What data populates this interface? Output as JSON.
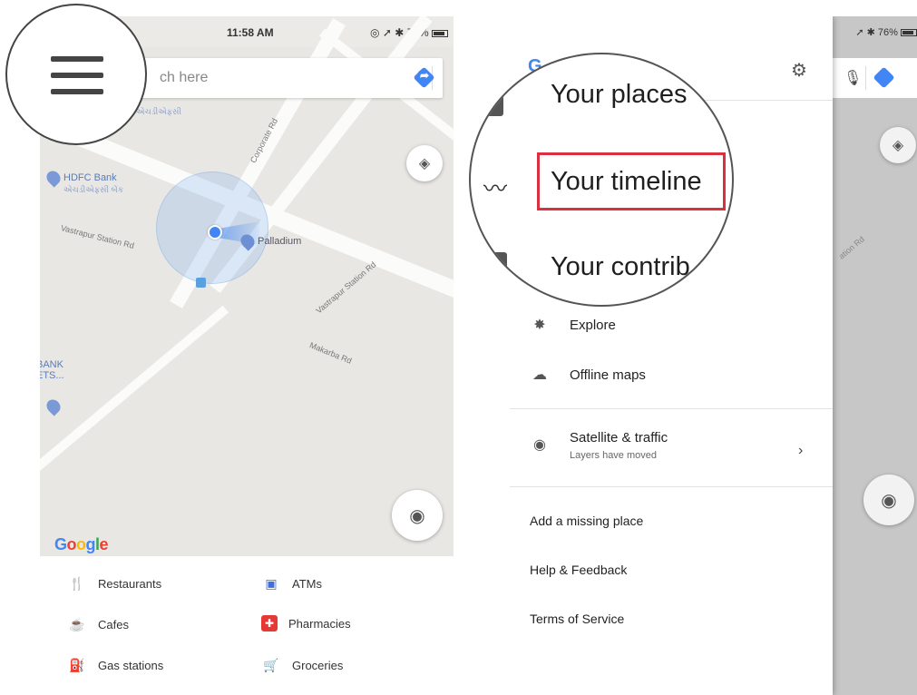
{
  "left_phone": {
    "status": {
      "time": "11:58 AM",
      "battery": "76%"
    },
    "search": {
      "placeholder": "ch here"
    },
    "map": {
      "poi_hdfc": {
        "name": "HDFC Bank",
        "sub": "એચડીએફસી બેંક"
      },
      "poi_bank_partial": {
        "name": "BANK",
        "sub": "ETS..."
      },
      "poi_top_sub": "એચડીએફસી",
      "poi_palladium": "Palladium",
      "roads": {
        "vastrapur_station_rd_1": "Vastrapur Station Rd",
        "vastrapur_station_rd_2": "Vastrapur Station Rd",
        "makarba_rd": "Makarba Rd",
        "corporate_rd": "Corporate Rd"
      },
      "logo": "Google"
    },
    "categories": [
      {
        "label": "Restaurants",
        "icon": "restaurant-icon",
        "color": "#e53935"
      },
      {
        "label": "ATMs",
        "icon": "atm-icon",
        "color": "#3f6fd9"
      },
      {
        "label": "Cafes",
        "icon": "cafe-icon",
        "color": "#f5a623"
      },
      {
        "label": "Pharmacies",
        "icon": "pharmacy-icon",
        "color": "#e53935"
      },
      {
        "label": "Gas stations",
        "icon": "gas-station-icon",
        "color": "#3f6fd9"
      },
      {
        "label": "Groceries",
        "icon": "grocery-icon",
        "color": "#2e9b46"
      }
    ]
  },
  "right_phone": {
    "status": {
      "battery": "76%"
    },
    "zoom": {
      "item1": "Your places",
      "item2": "Your timeline",
      "item3": "Your contrib"
    },
    "menu": {
      "explore": "Explore",
      "offline_maps": "Offline maps",
      "satellite_title": "Satellite & traffic",
      "satellite_sub": "Layers have moved",
      "add_place": "Add a missing place",
      "help": "Help & Feedback",
      "terms": "Terms of Service"
    },
    "map_road_label": "ation Rd"
  },
  "colors": {
    "accent_blue": "#4285f4",
    "highlight_red": "#d9313f"
  }
}
